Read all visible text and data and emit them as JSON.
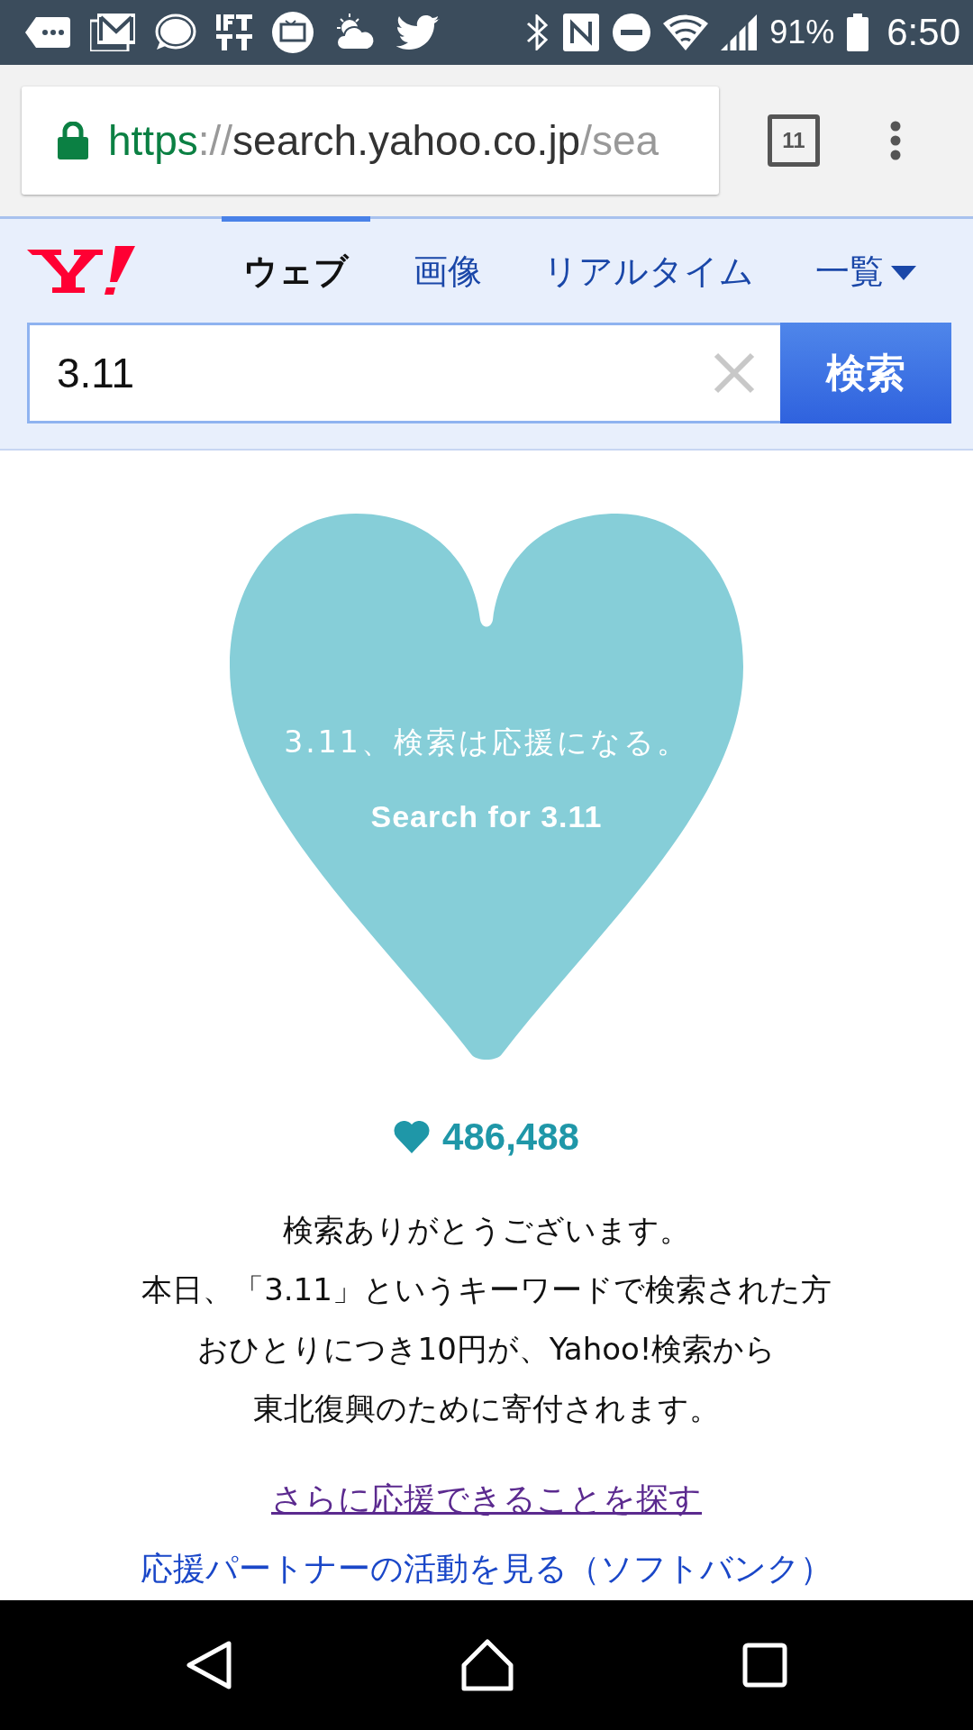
{
  "status_bar": {
    "battery": "91%",
    "time": "6:50"
  },
  "url_bar": {
    "scheme": "https",
    "separator": "://",
    "host": "search.yahoo.co.jp",
    "path": "/sea",
    "tab_count": "11"
  },
  "tabs": [
    {
      "label": "ウェブ",
      "selected": true
    },
    {
      "label": "画像",
      "selected": false
    },
    {
      "label": "リアルタイム",
      "selected": false
    }
  ],
  "more_menu": {
    "label": "一覧"
  },
  "search": {
    "value": "3.11",
    "button": "検索"
  },
  "campaign": {
    "headline": "3.11、検索は応援になる。",
    "subtitle": "Search for 3.11",
    "count": "486,488"
  },
  "message": [
    "検索ありがとうございます。",
    "本日、「3.11」というキーワードで検索された方",
    "おひとりにつき10円が、Yahoo!検索から",
    "東北復興のために寄付されます。"
  ],
  "links": [
    {
      "text": "さらに応援できることを探す",
      "visited": true
    },
    {
      "text": "応援パートナーの活動を見る（ソフトバンク）",
      "visited": false
    }
  ]
}
